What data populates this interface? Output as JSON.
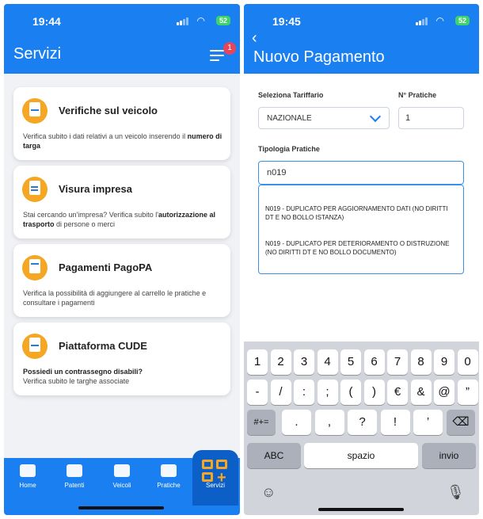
{
  "left": {
    "status_time": "19:44",
    "battery": "52",
    "title": "Servizi",
    "notif_count": "1",
    "cards": [
      {
        "title": "Verifiche sul veicolo",
        "desc_plain": "Verifica subito i dati relativi a un veicolo inserendo il ",
        "desc_bold": "numero di targa",
        "desc_tail": ""
      },
      {
        "title": "Visura impresa",
        "desc_plain": "Stai cercando un'impresa? Verifica subito l'",
        "desc_bold": "autorizzazione al trasporto",
        "desc_tail": " di persone o merci"
      },
      {
        "title": "Pagamenti PagoPA",
        "desc_plain": "Verifica la possibilità di aggiungere al carrello le pratiche e consultare i pagamenti",
        "desc_bold": "",
        "desc_tail": ""
      },
      {
        "title": "Piattaforma CUDE",
        "desc_plain": "",
        "desc_bold": "Possiedi un contrassegno disabili?",
        "desc_tail": "Verifica subito le targhe associate"
      }
    ],
    "tabs": [
      "Home",
      "Patenti",
      "Veicoli",
      "Pratiche",
      "Servizi"
    ]
  },
  "right": {
    "status_time": "19:45",
    "battery": "52",
    "back_glyph": "‹",
    "title": "Nuovo Pagamento",
    "tariffario_label": "Seleziona Tariffario",
    "tariffario_value": "NAZIONALE",
    "pratiche_label": "N° Pratiche",
    "pratiche_value": "1",
    "tipologia_label": "Tipologia Pratiche",
    "tipologia_value": "n019",
    "suggestions": [
      "N019 - DUPLICATO PER AGGIORNAMENTO DATI (NO DIRITTI DT E NO BOLLO ISTANZA)",
      "N019 - DUPLICATO PER DETERIORAMENTO O DISTRUZIONE (NO DIRITTI DT E NO BOLLO DOCUMENTO)"
    ],
    "keyboard": {
      "row1": [
        "1",
        "2",
        "3",
        "4",
        "5",
        "6",
        "7",
        "8",
        "9",
        "0"
      ],
      "row2": [
        "-",
        "/",
        ":",
        ";",
        "(",
        ")",
        "€",
        "&",
        "@",
        "”"
      ],
      "row3_shift": "#+=",
      "row3": [
        ".",
        ",",
        "?",
        "!",
        "’"
      ],
      "abc": "ABC",
      "space": "spazio",
      "enter": "invio"
    }
  }
}
